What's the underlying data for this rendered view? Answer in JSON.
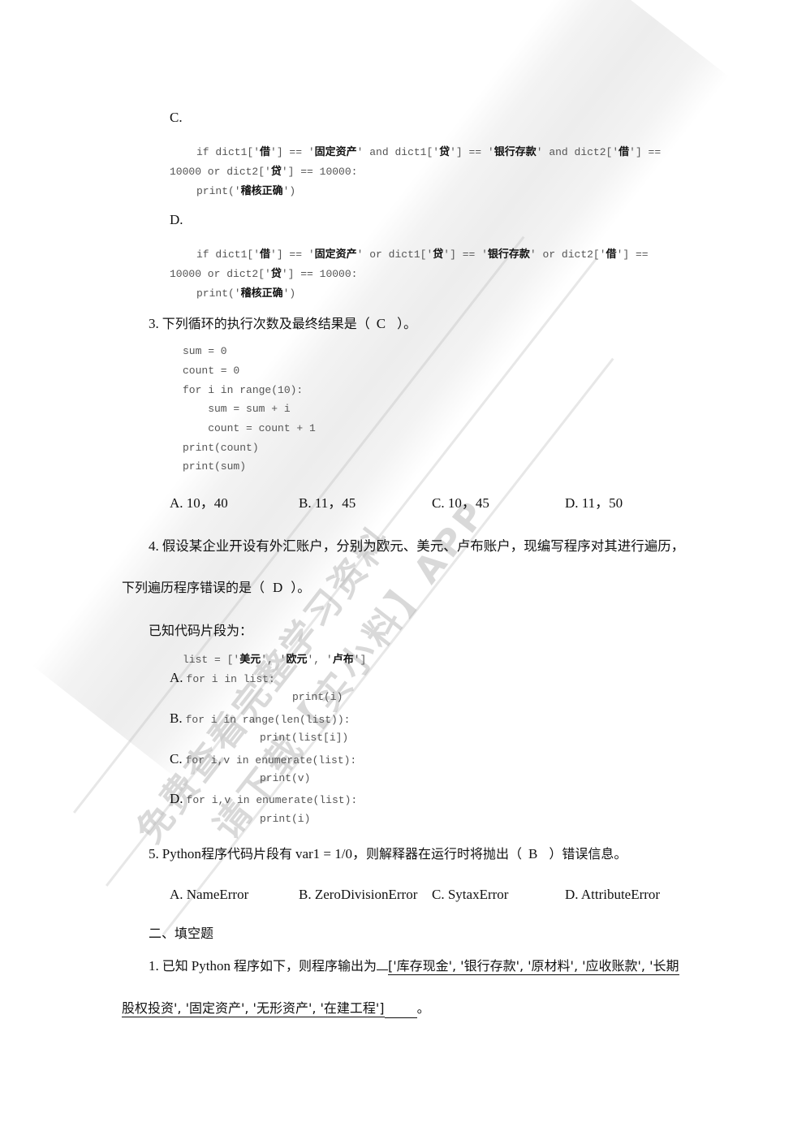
{
  "watermark": {
    "line1": "免费查看完整学习资料",
    "line2": "请下载【实小料】APP"
  },
  "q2": {
    "optC": {
      "label": "C.",
      "line1_parts": [
        "if dict1['",
        "借",
        "'] == '",
        "固定资产",
        "' and dict1['",
        "贷",
        "'] == '",
        "银行存款",
        "' and dict2['",
        "借",
        "'] =="
      ],
      "line2_parts": [
        "10000 or dict2['",
        "贷",
        "'] == 10000:"
      ],
      "line3_parts": [
        "print('",
        "稽核正确",
        "')"
      ]
    },
    "optD": {
      "label": "D.",
      "line1_parts": [
        "if dict1['",
        "借",
        "'] == '",
        "固定资产",
        "' or dict1['",
        "贷",
        "'] == '",
        "银行存款",
        "' or dict2['",
        "借",
        "'] =="
      ],
      "line2_parts": [
        "10000 or dict2['",
        "贷",
        "'] == 10000:"
      ],
      "line3_parts": [
        "print('",
        "稽核正确",
        "')"
      ]
    }
  },
  "q3": {
    "number": "3.",
    "stem": "下列循环的执行次数及最终结果是（",
    "answer": "C",
    "stem_end": "）。",
    "code": [
      "sum = 0",
      "count = 0",
      "for i in range(10):",
      "    sum = sum + i",
      "    count = count + 1",
      "print(count)",
      "print(sum)"
    ],
    "options": [
      {
        "letter": "A.",
        "text": "10，40"
      },
      {
        "letter": "B.",
        "text": "11，45"
      },
      {
        "letter": "C.",
        "text": "10，45"
      },
      {
        "letter": "D.",
        "text": "11，50"
      }
    ]
  },
  "q4": {
    "number": "4.",
    "stem_line1": "假设某企业开设有外汇账户，分别为欧元、美元、卢布账户，现编写程序对其进行遍历，",
    "stem_line2": "下列遍历程序错误的是（",
    "answer": "D",
    "stem_end": "）。",
    "known": "已知代码片段为：",
    "list_parts": [
      "list = ['",
      "美元",
      "', '",
      "欧元",
      "', '",
      "卢布",
      "']"
    ],
    "options": [
      {
        "letter": "A.",
        "line1": "for i in list:",
        "line2": "print(i)"
      },
      {
        "letter": "B.",
        "line1": "for i in range(len(list)):",
        "line2": "print(list[i])"
      },
      {
        "letter": "C.",
        "line1": "for i,v in enumerate(list):",
        "line2": "print(v)"
      },
      {
        "letter": "D.",
        "line1": "for i,v in enumerate(list):",
        "line2": "print(i)"
      }
    ]
  },
  "q5": {
    "number": "5.",
    "stem_a": "Python",
    "stem_b": "程序代码片段有",
    "stem_c": "var1 = 1/0，",
    "stem_d": "则解释器在运行时将抛出（",
    "answer": "B",
    "stem_end": "）错误信息。",
    "options": [
      {
        "letter": "A.",
        "text": "NameError"
      },
      {
        "letter": "B.",
        "text": "ZeroDivisionError"
      },
      {
        "letter": "C.",
        "text": "SytaxError"
      },
      {
        "letter": "D.",
        "text": "AttributeError"
      }
    ]
  },
  "section2": {
    "title": "二、填空题",
    "q1": {
      "number": "1.",
      "stem_a": "已知",
      "stem_b": "Python",
      "stem_c": "程序如下，则程序输出为",
      "answer_line1": "['库存现金', '银行存款', '原材料', '应收账款', '长期",
      "answer_line2": "股权投资', '固定资产', '无形资产', '在建工程']",
      "end": "。"
    }
  }
}
